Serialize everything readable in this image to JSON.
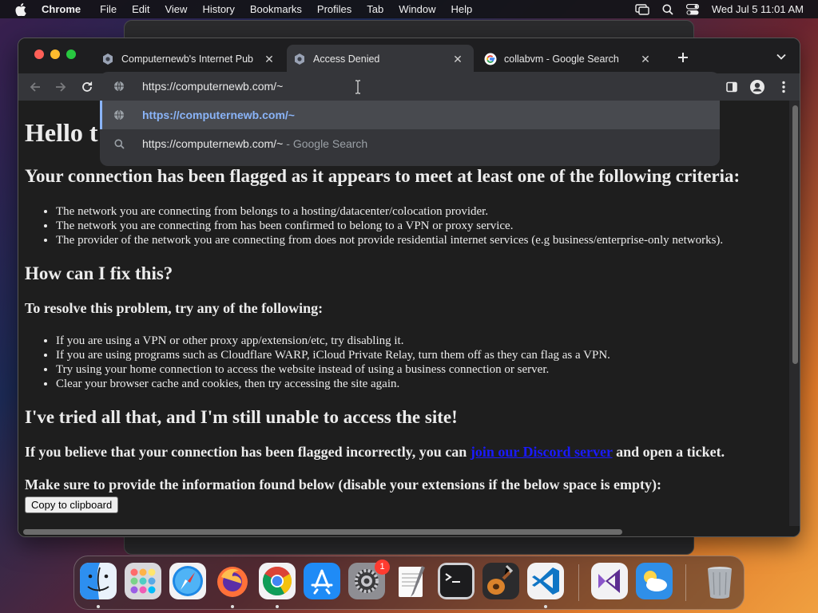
{
  "menubar": {
    "app_name": "Chrome",
    "items": [
      "File",
      "Edit",
      "View",
      "History",
      "Bookmarks",
      "Profiles",
      "Tab",
      "Window",
      "Help"
    ],
    "clock": "Wed Jul 5  11:01 AM"
  },
  "browser": {
    "tabs": [
      {
        "label": "Computernewb's Internet Pub",
        "favicon": "computernewb-icon",
        "active": false
      },
      {
        "label": "Access Denied",
        "favicon": "computernewb-icon",
        "active": true
      },
      {
        "label": "collabvm - Google Search",
        "favicon": "google-icon",
        "active": false
      }
    ],
    "omnibox": {
      "input_text": "https://computernewb.com/~",
      "suggestions": [
        {
          "text": "https://computernewb.com/~",
          "icon": "globe-icon",
          "selected": true
        },
        {
          "text": "https://computernewb.com/~",
          "suffix": "- Google Search",
          "icon": "search-icon",
          "selected": false
        }
      ]
    }
  },
  "page": {
    "title": "Hello t",
    "flagged_heading": "Your connection has been flagged as it appears to meet at least one of the following criteria:",
    "criteria": [
      "The network you are connecting from belongs to a hosting/datacenter/colocation provider.",
      "The network you are connecting from has been confirmed to belong to a VPN or proxy service.",
      "The provider of the network you are connecting from does not provide residential internet services (e.g business/enterprise-only networks)."
    ],
    "fix_heading": "How can I fix this?",
    "resolve_heading": "To resolve this problem, try any of the following:",
    "fixes": [
      "If you are using a VPN or other proxy app/extension/etc, try disabling it.",
      "If you are using programs such as Cloudflare WARP, iCloud Private Relay, turn them off as they can flag as a VPN.",
      "Try using your home connection to access the website instead of using a business connection or server.",
      "Clear your browser cache and cookies, then try accessing the site again."
    ],
    "still_heading": "I've tried all that, and I'm still unable to access the site!",
    "incorrect_prefix": "If you believe that your connection has been flagged incorrectly, you can ",
    "discord_link": "join our Discord server",
    "incorrect_suffix": " and open a ticket.",
    "info_heading": "Make sure to provide the information found below (disable your extensions if the below space is empty):",
    "copy_button": "Copy to clipboard"
  },
  "dock": {
    "apps": [
      "Finder",
      "Launchpad",
      "Safari",
      "Firefox",
      "Google Chrome",
      "App Store",
      "System Settings",
      "TextEdit",
      "Terminal",
      "GarageBand",
      "Visual Studio Code",
      "Visual Studio",
      "Weather",
      "Trash"
    ],
    "settings_badge": "1"
  }
}
